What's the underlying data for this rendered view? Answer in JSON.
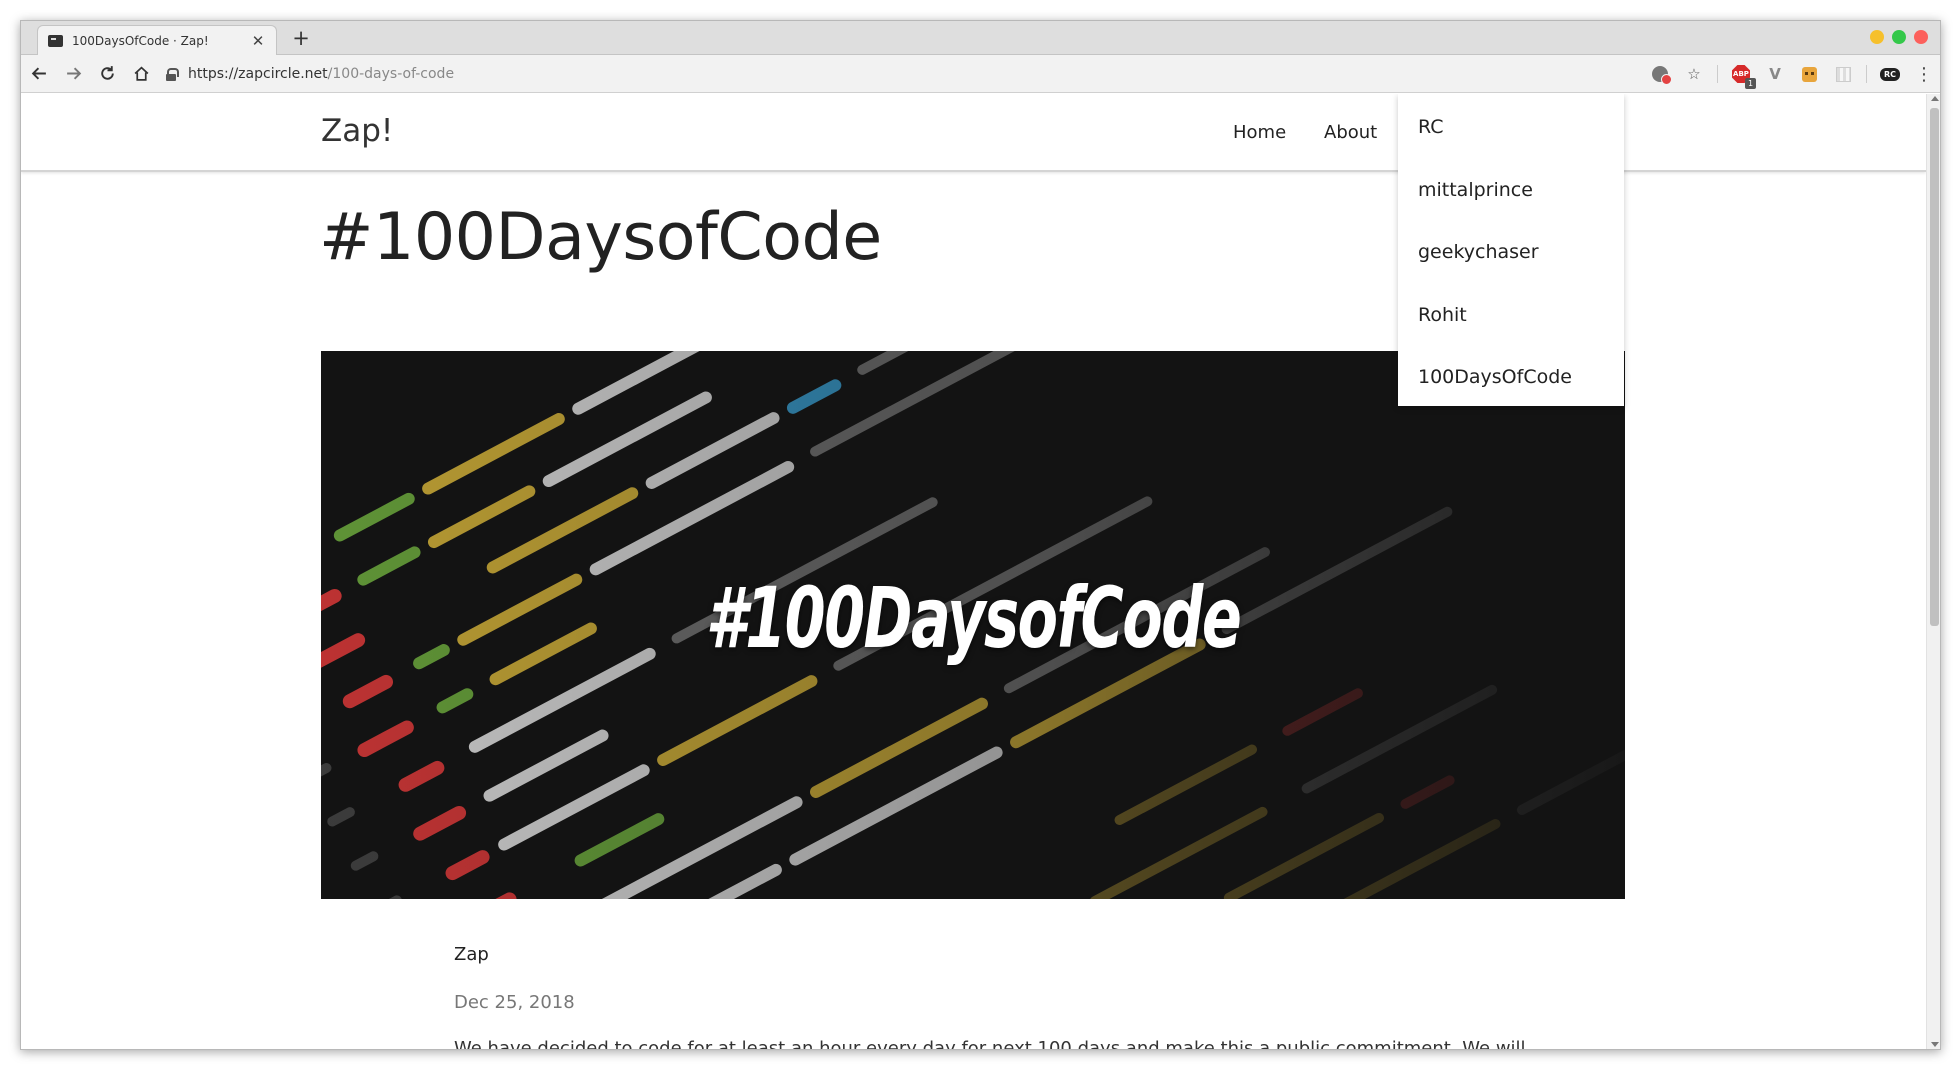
{
  "browser": {
    "tab": {
      "title": "100DaysOfCode · Zap!",
      "close": "✕",
      "favicon": "terminal-icon"
    },
    "new_tab": "+",
    "url": {
      "host": "https://zapcircle.net",
      "path": "/100-days-of-code"
    },
    "nav": {
      "back": "back-arrow-icon",
      "forward": "forward-arrow-icon",
      "reload": "reload-icon",
      "home": "home-icon"
    },
    "extensions": {
      "abp_label": "ABP",
      "abp_badge": "1",
      "rc_label": "RC",
      "menu": "⋮",
      "star": "☆"
    }
  },
  "site": {
    "brand": "Zap!",
    "nav": {
      "home": "Home",
      "about": "About"
    },
    "dropdown": [
      "RC",
      "mittalprince",
      "geekychaser",
      "Rohit",
      "100DaysOfCode"
    ]
  },
  "post": {
    "title": "#100DaysofCode",
    "hero_text": "#100DaysofCode",
    "author": "Zap",
    "date": "Dec 25, 2018",
    "body_start": "We have decided to code for at least an hour every day for next 100 days and make this a public commitment. We will"
  },
  "colors": {
    "accent": "#222222",
    "code_red": "#e03a3a",
    "code_yellow": "#d9b63a",
    "code_green": "#6fae3e",
    "code_white": "#e6e6e6",
    "code_blue": "#3aa4d9"
  }
}
